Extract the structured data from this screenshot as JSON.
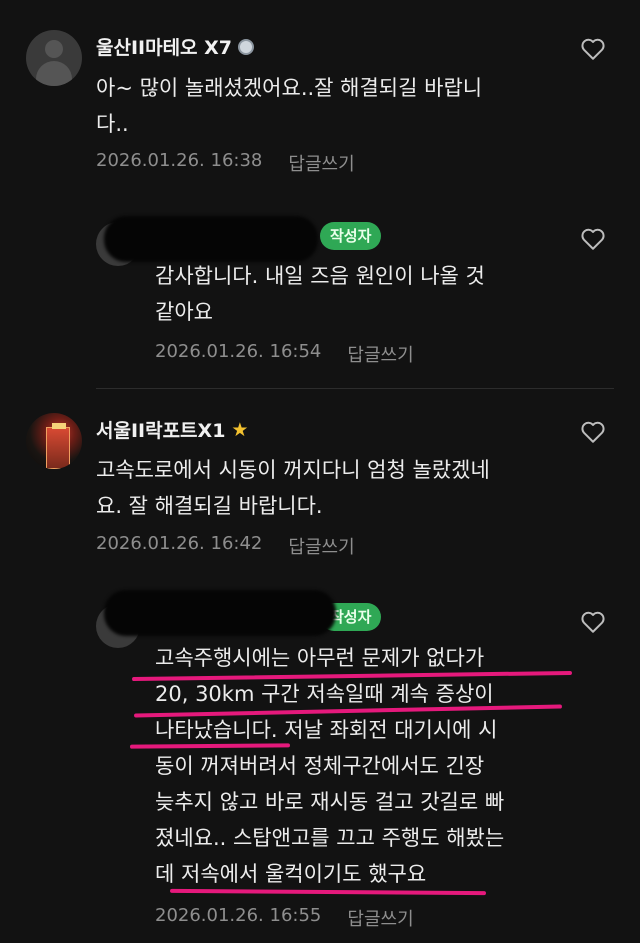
{
  "comments": [
    {
      "nickname": "울산II마테오 X7",
      "text_lines": [
        "아~ 많이 놀래셨겠어요..잘 해결되길 바랍니",
        "다.."
      ],
      "timestamp": "2026.01.26. 16:38",
      "reply_label": "답글쓰기"
    },
    {
      "author_badge": "작성자",
      "text_lines": [
        "감사합니다. 내일 즈음 원인이 나올 것",
        "같아요"
      ],
      "timestamp": "2026.01.26. 16:54",
      "reply_label": "답글쓰기"
    },
    {
      "nickname": "서울II락포트X1",
      "text_lines": [
        "고속도로에서 시동이 꺼지다니 엄청 놀랐겠네",
        "요. 잘 해결되길 바랍니다."
      ],
      "timestamp": "2026.01.26. 16:42",
      "reply_label": "답글쓰기"
    },
    {
      "author_badge": "작성자",
      "text_lines": [
        "고속주행시에는 아무런 문제가 없다가",
        "20, 30km 구간 저속일때 계속 증상이",
        "나타났습니다. 저날 좌회전 대기시에 시",
        "동이 꺼져버려서 정체구간에서도 긴장",
        "늦추지 않고 바로 재시동 걸고 갓길로 빠",
        "졌네요.. 스탑앤고를 끄고 주행도 해봤는",
        "데 저속에서 울컥이기도 했구요"
      ],
      "timestamp": "2026.01.26. 16:55",
      "reply_label": "답글쓰기"
    }
  ],
  "colors": {
    "background": "#121212",
    "author_badge": "#2fa855",
    "highlight": "#e5197c",
    "star": "#f3c12f"
  },
  "icons": {
    "like": "heart-outline-icon",
    "medal": "medal-icon",
    "star": "star-icon"
  }
}
